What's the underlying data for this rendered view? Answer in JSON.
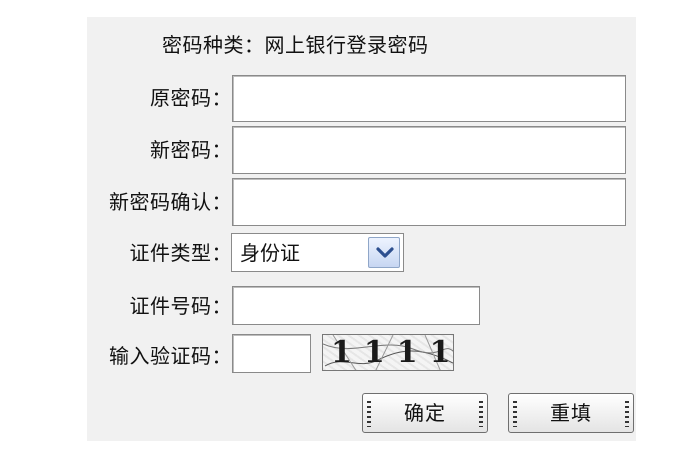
{
  "form": {
    "title": "密码种类：网上银行登录密码",
    "fields": {
      "old_password": {
        "label": "原密码：",
        "value": ""
      },
      "new_password": {
        "label": "新密码：",
        "value": ""
      },
      "confirm_password": {
        "label": "新密码确认：",
        "value": ""
      },
      "id_type": {
        "label": "证件类型：",
        "selected": "身份证"
      },
      "id_number": {
        "label": "证件号码：",
        "value": ""
      },
      "captcha_input": {
        "label": "输入验证码：",
        "value": ""
      }
    },
    "captcha_image_text": "1111",
    "buttons": {
      "confirm": "确定",
      "reset": "重填"
    },
    "colors": {
      "panel_bg": "#f1f1f1",
      "input_border": "#8a8a8a",
      "select_button": "#c7d6f2"
    },
    "icons": {
      "select_arrow": "chevron-down-icon"
    }
  }
}
